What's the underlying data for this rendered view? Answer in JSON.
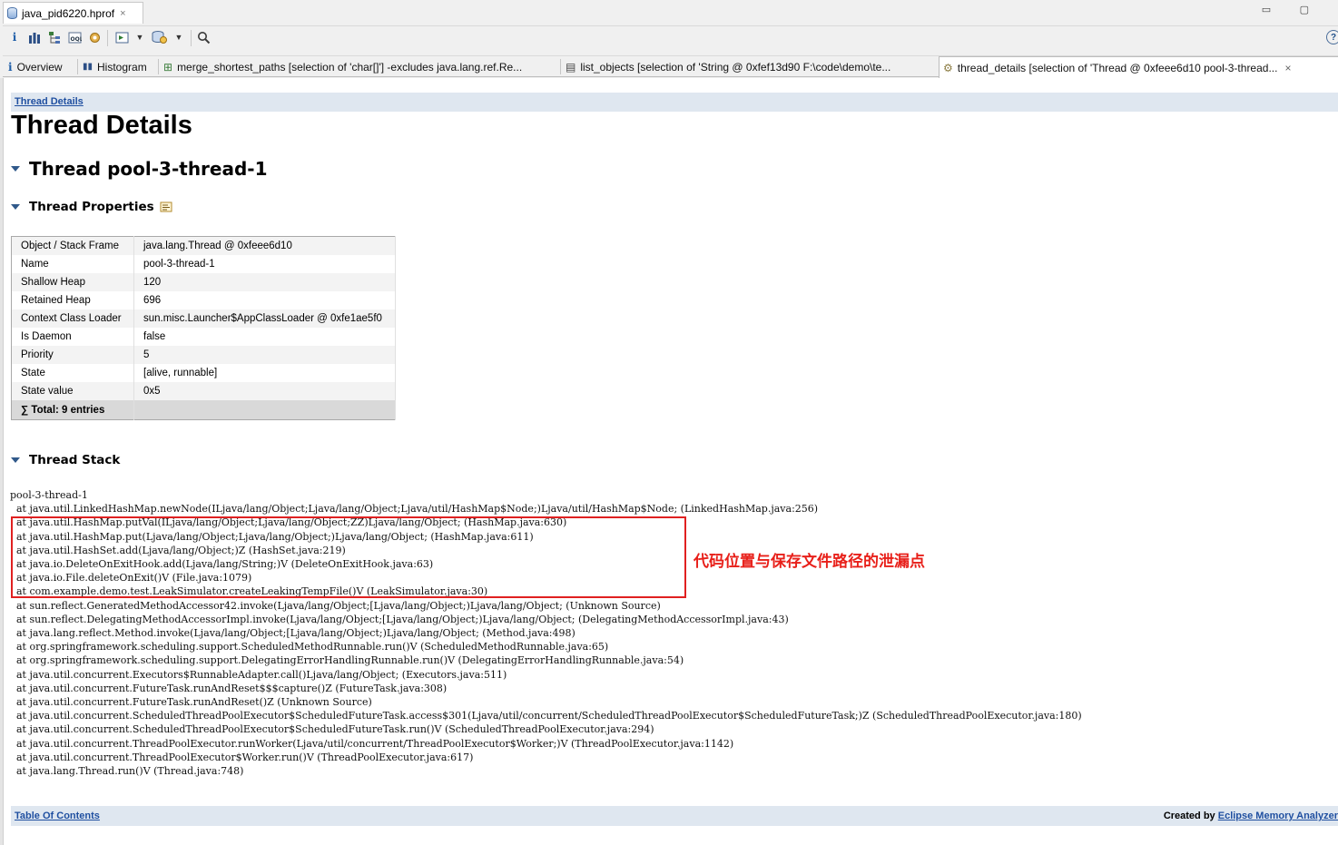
{
  "editor": {
    "file_tab": "java_pid6220.hprof",
    "close_glyph": "×",
    "window_buttons": "▭ ▢"
  },
  "toolbar": {
    "icons": [
      "info-icon",
      "histogram-icon",
      "dominator-tree-icon",
      "oql-icon",
      "heap-dump-overview-icon",
      "run-report-icon",
      "query-browser-icon",
      "find-object-icon",
      "help-icon"
    ],
    "info_glyph": "i",
    "help_glyph": "?"
  },
  "view_tabs": [
    {
      "label": "Overview",
      "icon": "info-icon",
      "glyph": "i"
    },
    {
      "label": "Histogram",
      "icon": "histogram-icon",
      "glyph": "▮▮"
    },
    {
      "label": "merge_shortest_paths  [selection of 'char[]'] -excludes java.lang.ref.Re...",
      "icon": "paths-icon",
      "glyph": "⊞"
    },
    {
      "label": "list_objects  [selection of 'String @ 0xfef13d90  F:\\code\\demo\\te...",
      "icon": "list-objects-icon",
      "glyph": "▤"
    },
    {
      "label": "thread_details  [selection of 'Thread @ 0xfeee6d10  pool-3-thread...",
      "icon": "thread-details-icon",
      "glyph": "⚙"
    }
  ],
  "view_tab_close": "×",
  "breadcrumb": "Thread Details",
  "page_title": "Thread Details",
  "thread_heading": "Thread pool-3-thread-1",
  "properties_heading": "Thread Properties",
  "properties": [
    [
      "Object / Stack Frame",
      "java.lang.Thread @ 0xfeee6d10"
    ],
    [
      "Name",
      "pool-3-thread-1"
    ],
    [
      "Shallow Heap",
      "120"
    ],
    [
      "Retained Heap",
      "696"
    ],
    [
      "Context Class Loader",
      "sun.misc.Launcher$AppClassLoader @ 0xfe1ae5f0"
    ],
    [
      "Is Daemon",
      "false"
    ],
    [
      "Priority",
      "5"
    ],
    [
      "State",
      "[alive, runnable]"
    ],
    [
      "State value",
      "0x5"
    ]
  ],
  "properties_total": "∑ Total: 9 entries",
  "stack_heading": "Thread Stack",
  "stack_lines": [
    "pool-3-thread-1",
    "  at java.util.LinkedHashMap.newNode(ILjava/lang/Object;Ljava/lang/Object;Ljava/util/HashMap$Node;)Ljava/util/HashMap$Node; (LinkedHashMap.java:256)",
    "  at java.util.HashMap.putVal(ILjava/lang/Object;Ljava/lang/Object;ZZ)Ljava/lang/Object; (HashMap.java:630)",
    "  at java.util.HashMap.put(Ljava/lang/Object;Ljava/lang/Object;)Ljava/lang/Object; (HashMap.java:611)",
    "  at java.util.HashSet.add(Ljava/lang/Object;)Z (HashSet.java:219)",
    "  at java.io.DeleteOnExitHook.add(Ljava/lang/String;)V (DeleteOnExitHook.java:63)",
    "  at java.io.File.deleteOnExit()V (File.java:1079)",
    "  at com.example.demo.test.LeakSimulator.createLeakingTempFile()V (LeakSimulator.java:30)",
    "  at sun.reflect.GeneratedMethodAccessor42.invoke(Ljava/lang/Object;[Ljava/lang/Object;)Ljava/lang/Object; (Unknown Source)",
    "  at sun.reflect.DelegatingMethodAccessorImpl.invoke(Ljava/lang/Object;[Ljava/lang/Object;)Ljava/lang/Object; (DelegatingMethodAccessorImpl.java:43)",
    "  at java.lang.reflect.Method.invoke(Ljava/lang/Object;[Ljava/lang/Object;)Ljava/lang/Object; (Method.java:498)",
    "  at org.springframework.scheduling.support.ScheduledMethodRunnable.run()V (ScheduledMethodRunnable.java:65)",
    "  at org.springframework.scheduling.support.DelegatingErrorHandlingRunnable.run()V (DelegatingErrorHandlingRunnable.java:54)",
    "  at java.util.concurrent.Executors$RunnableAdapter.call()Ljava/lang/Object; (Executors.java:511)",
    "  at java.util.concurrent.FutureTask.runAndReset$$$capture()Z (FutureTask.java:308)",
    "  at java.util.concurrent.FutureTask.runAndReset()Z (Unknown Source)",
    "  at java.util.concurrent.ScheduledThreadPoolExecutor$ScheduledFutureTask.access$301(Ljava/util/concurrent/ScheduledThreadPoolExecutor$ScheduledFutureTask;)Z (ScheduledThreadPoolExecutor.java:180)",
    "  at java.util.concurrent.ScheduledThreadPoolExecutor$ScheduledFutureTask.run()V (ScheduledThreadPoolExecutor.java:294)",
    "  at java.util.concurrent.ThreadPoolExecutor.runWorker(Ljava/util/concurrent/ThreadPoolExecutor$Worker;)V (ThreadPoolExecutor.java:1142)",
    "  at java.util.concurrent.ThreadPoolExecutor$Worker.run()V (ThreadPoolExecutor.java:617)",
    "  at java.lang.Thread.run()V (Thread.java:748)"
  ],
  "annotation": "代码位置与保存文件路径的泄漏点",
  "annotation_color": "#e8201a",
  "footer": {
    "toc": "Table Of Contents",
    "created_prefix": "Created by ",
    "created_link": "Eclipse Memory Analyzer"
  },
  "colors": {
    "link": "#1f4fa0",
    "band": "#dfe7f0",
    "chevron": "#30598a"
  }
}
